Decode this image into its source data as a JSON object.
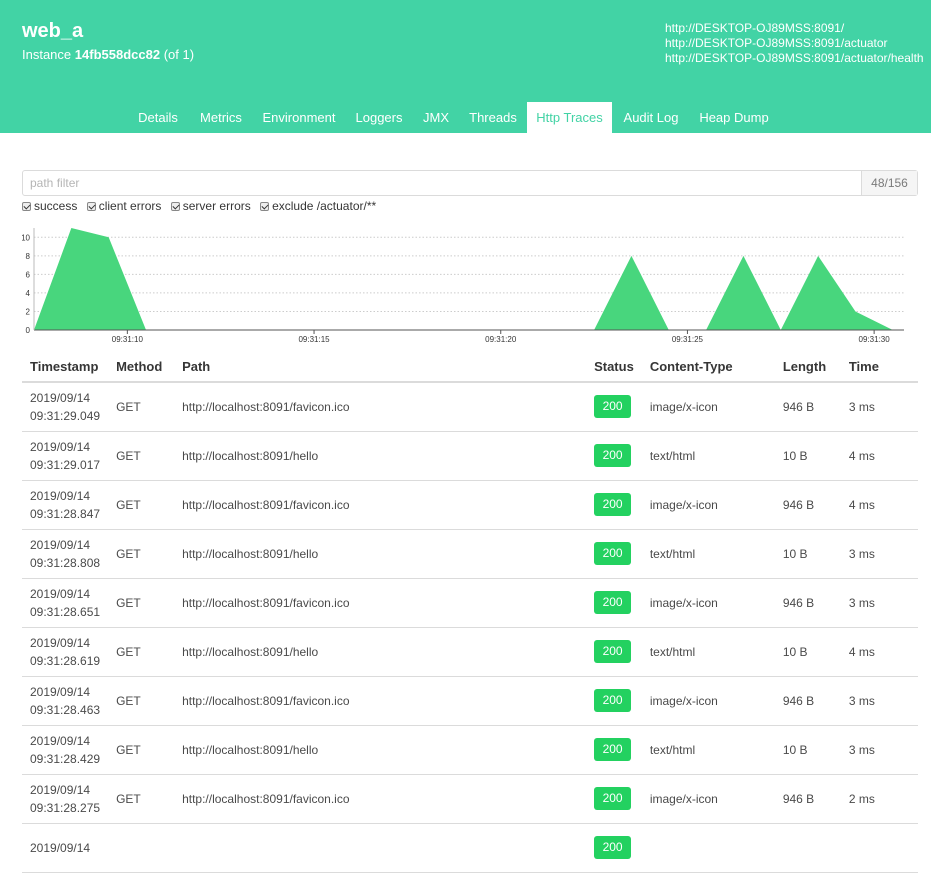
{
  "header": {
    "app_name": "web_a",
    "instance_prefix": "Instance",
    "instance_id": "14fb558dcc82",
    "instance_count": "(of 1)",
    "urls": [
      "http://DESKTOP-OJ89MSS:8091/",
      "http://DESKTOP-OJ89MSS:8091/actuator",
      "http://DESKTOP-OJ89MSS:8091/actuator/health"
    ],
    "accent_color": "#42d3a5"
  },
  "tabs": [
    {
      "label": "Details",
      "active": false
    },
    {
      "label": "Metrics",
      "active": false
    },
    {
      "label": "Environment",
      "active": false
    },
    {
      "label": "Loggers",
      "active": false
    },
    {
      "label": "JMX",
      "active": false
    },
    {
      "label": "Threads",
      "active": false
    },
    {
      "label": "Http Traces",
      "active": true
    },
    {
      "label": "Audit Log",
      "active": false
    },
    {
      "label": "Heap Dump",
      "active": false
    }
  ],
  "filter": {
    "placeholder": "path filter",
    "value": "",
    "count": "48/156"
  },
  "checkboxes": [
    {
      "label": "success",
      "checked": true
    },
    {
      "label": "client errors",
      "checked": true
    },
    {
      "label": "server errors",
      "checked": true
    },
    {
      "label": "exclude /actuator/**",
      "checked": true
    }
  ],
  "chart_data": {
    "type": "area",
    "x_tick_labels": [
      "09:31:10",
      "09:31:15",
      "09:31:20",
      "09:31:25",
      "09:31:30"
    ],
    "y_tick_labels": [
      "0",
      "2",
      "4",
      "6",
      "8",
      "10"
    ],
    "ylim": [
      0,
      11
    ],
    "xlim_seconds": [
      7.5,
      30.8
    ],
    "x_seconds": [
      7.5,
      8.5,
      9.5,
      10.5,
      11.5,
      12.5,
      13.5,
      14.5,
      15.5,
      16.5,
      17.5,
      18.5,
      19.5,
      20.5,
      21.5,
      22.5,
      23.5,
      24.5,
      25.5,
      26.5,
      27.5,
      28.5,
      29.5,
      30.5
    ],
    "values": [
      0,
      11,
      10,
      0,
      0,
      0,
      0,
      0,
      0,
      0,
      0,
      0,
      0,
      0,
      0,
      0,
      8,
      0,
      0,
      8,
      0,
      8,
      2,
      0
    ],
    "color": "#48d67d",
    "grid": true
  },
  "table": {
    "headers": [
      "Timestamp",
      "Method",
      "Path",
      "Status",
      "Content-Type",
      "Length",
      "Time"
    ],
    "rows": [
      {
        "date": "2019/09/14",
        "time": "09:31:29.049",
        "method": "GET",
        "path": "http://localhost:8091/favicon.ico",
        "status": "200",
        "content_type": "image/x-icon",
        "length": "946 B",
        "duration": "3 ms"
      },
      {
        "date": "2019/09/14",
        "time": "09:31:29.017",
        "method": "GET",
        "path": "http://localhost:8091/hello",
        "status": "200",
        "content_type": "text/html",
        "length": "10 B",
        "duration": "4 ms"
      },
      {
        "date": "2019/09/14",
        "time": "09:31:28.847",
        "method": "GET",
        "path": "http://localhost:8091/favicon.ico",
        "status": "200",
        "content_type": "image/x-icon",
        "length": "946 B",
        "duration": "4 ms"
      },
      {
        "date": "2019/09/14",
        "time": "09:31:28.808",
        "method": "GET",
        "path": "http://localhost:8091/hello",
        "status": "200",
        "content_type": "text/html",
        "length": "10 B",
        "duration": "3 ms"
      },
      {
        "date": "2019/09/14",
        "time": "09:31:28.651",
        "method": "GET",
        "path": "http://localhost:8091/favicon.ico",
        "status": "200",
        "content_type": "image/x-icon",
        "length": "946 B",
        "duration": "3 ms"
      },
      {
        "date": "2019/09/14",
        "time": "09:31:28.619",
        "method": "GET",
        "path": "http://localhost:8091/hello",
        "status": "200",
        "content_type": "text/html",
        "length": "10 B",
        "duration": "4 ms"
      },
      {
        "date": "2019/09/14",
        "time": "09:31:28.463",
        "method": "GET",
        "path": "http://localhost:8091/favicon.ico",
        "status": "200",
        "content_type": "image/x-icon",
        "length": "946 B",
        "duration": "3 ms"
      },
      {
        "date": "2019/09/14",
        "time": "09:31:28.429",
        "method": "GET",
        "path": "http://localhost:8091/hello",
        "status": "200",
        "content_type": "text/html",
        "length": "10 B",
        "duration": "3 ms"
      },
      {
        "date": "2019/09/14",
        "time": "09:31:28.275",
        "method": "GET",
        "path": "http://localhost:8091/favicon.ico",
        "status": "200",
        "content_type": "image/x-icon",
        "length": "946 B",
        "duration": "2 ms"
      },
      {
        "date": "2019/09/14",
        "time": "",
        "method": "",
        "path": "",
        "status": "200",
        "content_type": "",
        "length": "",
        "duration": ""
      }
    ],
    "status_color": "#23d160"
  }
}
